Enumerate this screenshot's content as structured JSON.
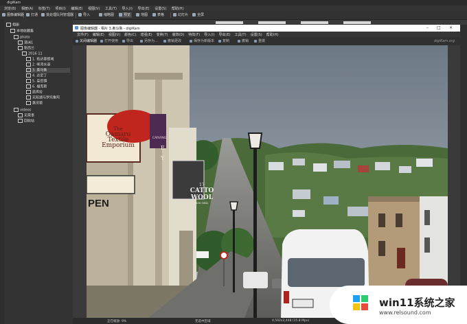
{
  "back_window": {
    "title": "digiKam",
    "menu": [
      "浏览(B)",
      "相册(A)",
      "标签(T)",
      "项目(I)",
      "编辑(E)",
      "视图(V)",
      "工具(T)",
      "导入(I)",
      "导出(E)",
      "设置(S)",
      "帮助(H)"
    ],
    "toolbar": {
      "editor_label": "图像编辑器",
      "import_label": "打通",
      "tools_label": "批处理队列管理器",
      "unknown_label": "导入",
      "thumbs_label": "缩略图",
      "preview_label": "预览",
      "map_label": "地图",
      "table_label": "表格",
      "slideshow_label": "幻灯片",
      "fullscreen_label": "全屏"
    },
    "tree": {
      "root": "相册",
      "collection": "本地收藏集",
      "items": [
        {
          "label": "photo",
          "sel": false
        },
        {
          "label": "澳洲1",
          "sel": false
        },
        {
          "label": "新西兰",
          "sel": false
        },
        {
          "label": "2016 11",
          "sel": false
        },
        {
          "label": "1. 抵达基督城",
          "sel": false
        },
        {
          "label": "2. 峡湾水道",
          "sel": false
        },
        {
          "label": "3. 奥马鲁",
          "sel": true
        },
        {
          "label": "4. 达尼丁",
          "sel": false
        },
        {
          "label": "5. 皇后镇",
          "sel": false
        },
        {
          "label": "6. 福克斯",
          "sel": false
        },
        {
          "label": "凯库拉",
          "sel": false
        },
        {
          "label": "无知湖与罗托鲁阿",
          "sel": false
        },
        {
          "label": "惠灵顿",
          "sel": false
        }
      ],
      "extra": [
        {
          "label": "videos"
        },
        {
          "label": "无需事"
        },
        {
          "label": "回收站"
        }
      ]
    }
  },
  "front_window": {
    "title": "图像编辑器 - 相片 3.奥马鲁 - digiKam",
    "menu": [
      "文件(F)",
      "编辑(E)",
      "视图(V)",
      "颜色(C)",
      "增强(E)",
      "变换(T)",
      "装饰(D)",
      "特效(F)",
      "导入(I)",
      "导出(E)",
      "工具(T)",
      "设置(S)",
      "帮助(H)"
    ],
    "toolbar": {
      "close_editor": "关闭编辑器",
      "open_with": "打开使用",
      "export": "导出",
      "save_as": "另存为...",
      "revert": "撤销更改",
      "send": "保存为新版本",
      "compare": "复制",
      "undo": "撤销",
      "redo": "重做"
    },
    "brand": "digiKam.org",
    "status": {
      "zoom": "正在缩放: 9%",
      "mode": "无选中区域",
      "info": "4,592x3,448 (15.8 Mpx)"
    },
    "photo_signs": {
      "oamaru1": "The",
      "oamaru2": "Oamaru",
      "oamaru3": "Textile",
      "oamaru4": "Emporium",
      "catto_num": "17",
      "catto1": "CATTO",
      "catto2": "WOOL",
      "catto_phone": "434 5442",
      "open": "PEN",
      "carving": "CARVING",
      "letter_e": "E",
      "letter_y": "Y"
    }
  },
  "watermark": {
    "text": "win11系统之家",
    "url": "www.relsound.com"
  },
  "colors": {
    "accent": "#4a90e2",
    "dark_bg": "#2b2b2b",
    "panel_bg": "#333333"
  }
}
